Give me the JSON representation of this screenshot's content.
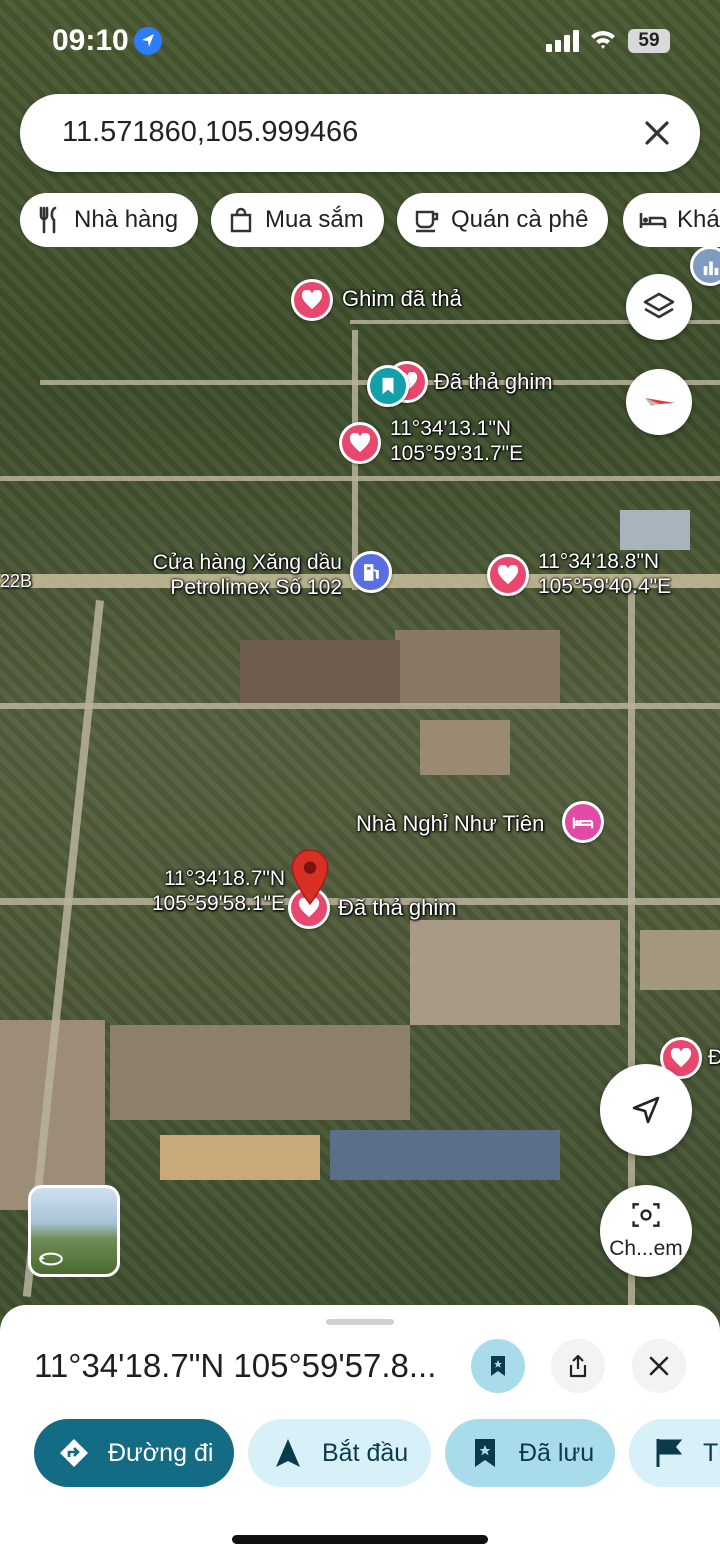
{
  "status_bar": {
    "time": "09:10",
    "battery": "59"
  },
  "search": {
    "value": "11.571860,105.999466"
  },
  "chips": [
    {
      "label": "Nhà hàng",
      "icon": "restaurant-icon"
    },
    {
      "label": "Mua sắm",
      "icon": "shopping-bag-icon"
    },
    {
      "label": "Quán cà phê",
      "icon": "coffee-icon"
    },
    {
      "label": "Khác",
      "icon": "hotel-bed-icon"
    }
  ],
  "map_labels": {
    "ghim_da_tha": "Ghim đã thả",
    "da_tha_ghim_top": "Đã thả ghim",
    "coord_pin_1_lat": "11°34'13.1\"N",
    "coord_pin_1_lng": "105°59'31.7\"E",
    "gas_station_line1": "Cửa hàng Xăng dầu",
    "gas_station_line2": "Petrolimex Số 102",
    "coord_pin_2_lat": "11°34'18.8\"N",
    "coord_pin_2_lng": "105°59'40.4\"E",
    "road_label": "22B",
    "guesthouse": "Nhà Nghỉ Như Tiên",
    "selected_lat": "11°34'18.7\"N",
    "selected_lng": "105°59'58.1\"E",
    "da_tha_ghim_selected": "Đã thả ghim",
    "edge_label": "Đ"
  },
  "camera_button_label": "Ch...em",
  "sheet": {
    "title": "11°34'18.7\"N 105°59'57.8...",
    "actions": [
      {
        "label": "Đường đi",
        "icon": "directions-icon"
      },
      {
        "label": "Bắt đầu",
        "icon": "navigation-arrow-icon"
      },
      {
        "label": "Đã lưu",
        "icon": "bookmark-icon"
      },
      {
        "label": "Th",
        "icon": "flag-icon"
      }
    ]
  },
  "colors": {
    "pin_pink": "#e8476e",
    "selected_pin_red": "#d93025",
    "primary_teal": "#146c84",
    "light_chip": "#d8f0f7",
    "saved_chip": "#a9dcea"
  }
}
